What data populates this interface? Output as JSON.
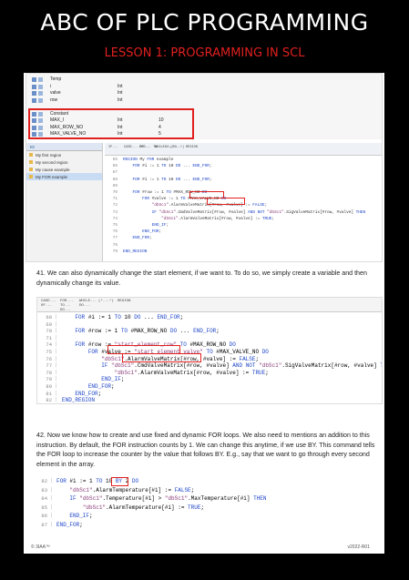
{
  "header": {
    "title": "ABC OF PLC PROGRAMMING",
    "subtitle": "LESSON 1: PROGRAMMING  IN SCL"
  },
  "colors": {
    "accent": "#e0201f",
    "keyword": "#1e45c8",
    "string": "#8b3c7a"
  },
  "shot1": {
    "vars": [
      {
        "name": "Temp",
        "type": "",
        "value": ""
      },
      {
        "name": "i",
        "type": "Int",
        "value": ""
      },
      {
        "name": "valve",
        "type": "Int",
        "value": ""
      },
      {
        "name": "row",
        "type": "Int",
        "value": ""
      },
      {
        "name": "",
        "type": "",
        "value": ""
      },
      {
        "name": "Constant",
        "type": "",
        "value": ""
      },
      {
        "name": "MAX_I",
        "type": "Int",
        "value": "10"
      },
      {
        "name": "MAX_ROW_NO",
        "type": "Int",
        "value": "4"
      },
      {
        "name": "MAX_VALVE_NO",
        "type": "Int",
        "value": "5"
      }
    ],
    "tree_header": "IO",
    "tree_items": [
      "My first region",
      "My second region",
      "My cause example",
      "My FOR example"
    ],
    "toolbar": [
      "IF...",
      "CASE... OF...",
      "FOR... TO... DO...",
      "WHILE... DO...",
      "(*...*)",
      "REGION"
    ],
    "lines": [
      {
        "n": "65",
        "t": "REGION My FOR example"
      },
      {
        "n": "66",
        "t": "    FOR #i := 1 TO 10 DO ... END_FOR;"
      },
      {
        "n": "67",
        "t": ""
      },
      {
        "n": "68",
        "t": "    FOR #i := 1 TO 10 DO ... END_FOR;"
      },
      {
        "n": "69",
        "t": ""
      },
      {
        "n": "70",
        "t": "    FOR #row := 1 TO #MAX_ROW_NO DO"
      },
      {
        "n": "71",
        "t": "        FOR #valve := 1 TO #MAX_VALVE_NO DO"
      },
      {
        "n": "72",
        "t": "            \"dbSc1\".AlarmValveMatrix[#row, #valve] := FALSE;"
      },
      {
        "n": "73",
        "t": "            IF \"dbSc1\".CmdValveMatrix[#row, #valve] AND NOT \"dbSc1\".SigValveMatrix[#row, #valve] THEN"
      },
      {
        "n": "74",
        "t": "                \"dbSc1\".AlarmValveMatrix[#row, #valve] := TRUE;"
      },
      {
        "n": "75",
        "t": "            END_IF;"
      },
      {
        "n": "76",
        "t": "        END_FOR;"
      },
      {
        "n": "77",
        "t": "    END_FOR;"
      },
      {
        "n": "78",
        "t": ""
      },
      {
        "n": "79",
        "t": "END_REGION"
      }
    ]
  },
  "para41": "41. We can also dynamically change the start element, if we want to. To do so, we simply create a variable and then dynamically change its value.",
  "shot2": {
    "toolbar": [
      "CASE... OF...",
      "FOR... TO... DO...",
      "WHILE... DO...",
      "(*...*)",
      "REGION"
    ],
    "lines": [
      {
        "n": "68",
        "t": "    FOR #i := 1 TO 10 DO ... END_FOR;"
      },
      {
        "n": "69",
        "t": ""
      },
      {
        "n": "70",
        "t": "    FOR #row := 1 TO #MAX_ROW_NO DO ... END_FOR;"
      },
      {
        "n": "71",
        "t": ""
      },
      {
        "n": "74",
        "t": "    FOR #row := \"start_element_row\" TO #MAX_ROW_NO DO"
      },
      {
        "n": "75",
        "t": "        FOR #valve := \"start_element_valve\" TO #MAX_VALVE_NO DO"
      },
      {
        "n": "76",
        "t": "            \"dbSc1\".AlarmValveMatrix[#row, #valve] := FALSE;"
      },
      {
        "n": "77",
        "t": "            IF \"dbSc1\".CmdValveMatrix[#row, #valve] AND NOT \"dbSc1\".SigValveMatrix[#row, #valve] THEN"
      },
      {
        "n": "78",
        "t": "                \"dbSc1\".AlarmValveMatrix[#row, #valve] := TRUE;"
      },
      {
        "n": "79",
        "t": "            END_IF;"
      },
      {
        "n": "80",
        "t": "        END_FOR;"
      },
      {
        "n": "81",
        "t": "    END_FOR;"
      },
      {
        "n": "82",
        "t": "END_REGION"
      }
    ]
  },
  "para42": "42. Now we know how to create and use fixed and dynamic FOR loops. We also need to mentions an addition to this instruction. By default, the FOR instruction counts by 1. We can change this anytime, if we use BY. This command tells the FOR loop to increase the counter by the value that follows BY. E.g., say that we want to go through every second element in the array.",
  "shot3": {
    "lines": [
      {
        "n": "82",
        "t": "FOR #i := 1 TO 10 BY 2 DO"
      },
      {
        "n": "83",
        "t": "    \"dbSc1\".AlarmTemperature[#i] := FALSE;"
      },
      {
        "n": "84",
        "t": "    IF \"dbSc1\".Temperature[#i] > \"dbSc1\".MaxTemperature[#i] THEN"
      },
      {
        "n": "85",
        "t": "        \"dbSc1\".AlarmTemperature[#i] := TRUE;"
      },
      {
        "n": "86",
        "t": "    END_IF;"
      },
      {
        "n": "87",
        "t": "END_FOR;"
      }
    ]
  },
  "footer": {
    "left": "© 3IAA™",
    "right": "v2022-R01"
  }
}
